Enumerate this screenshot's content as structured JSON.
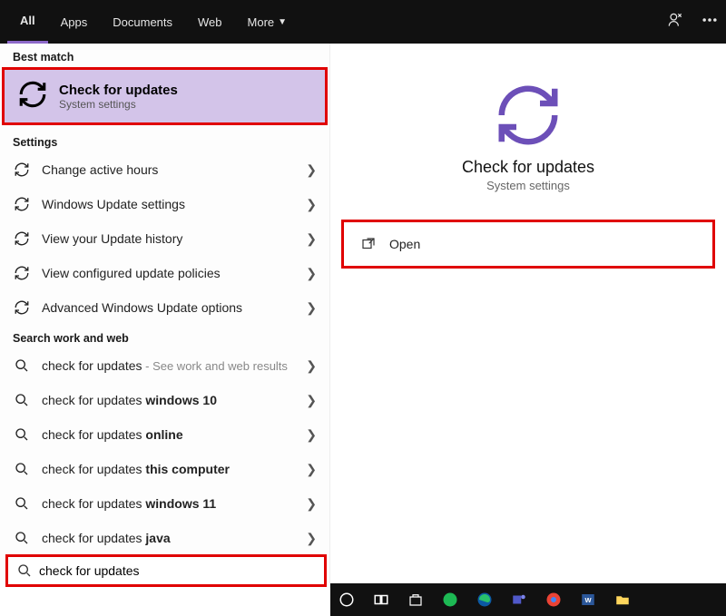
{
  "topbar": {
    "tabs": [
      "All",
      "Apps",
      "Documents",
      "Web",
      "More"
    ],
    "active_index": 0
  },
  "left": {
    "best_match_header": "Best match",
    "best_match": {
      "title": "Check for updates",
      "subtitle": "System settings"
    },
    "settings_header": "Settings",
    "settings_items": [
      {
        "label": "Change active hours"
      },
      {
        "label": "Windows Update settings"
      },
      {
        "label": "View your Update history"
      },
      {
        "label": "View configured update policies"
      },
      {
        "label": "Advanced Windows Update options"
      }
    ],
    "web_header": "Search work and web",
    "web_items": [
      {
        "prefix": "check for updates",
        "suffix": "",
        "hint": " - See work and web results"
      },
      {
        "prefix": "check for updates ",
        "suffix": "windows 10",
        "hint": ""
      },
      {
        "prefix": "check for updates ",
        "suffix": "online",
        "hint": ""
      },
      {
        "prefix": "check for updates ",
        "suffix": "this computer",
        "hint": ""
      },
      {
        "prefix": "check for updates ",
        "suffix": "windows 11",
        "hint": ""
      },
      {
        "prefix": "check for updates ",
        "suffix": "java",
        "hint": ""
      }
    ],
    "search_value": "check for updates"
  },
  "preview": {
    "title": "Check for updates",
    "subtitle": "System settings",
    "open_label": "Open"
  }
}
